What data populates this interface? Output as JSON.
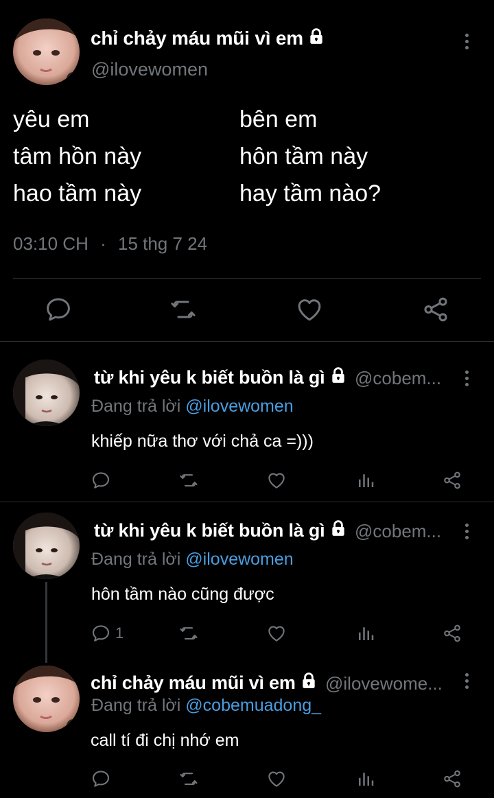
{
  "main_tweet": {
    "author_name": "chỉ chảy máu mũi vì em",
    "handle": "@ilovewomen",
    "poem_left": [
      "yêu em",
      "tâm hồn này",
      "hao tầm này"
    ],
    "poem_right": [
      "bên em",
      "hôn tầm này",
      "hay tầm nào?"
    ],
    "time": "03:10 CH",
    "separator": "·",
    "date": "15 thg 7 24"
  },
  "replies": [
    {
      "author_name": "từ khi yêu k biết buồn là gì",
      "handle": "@cobem...",
      "replying_prefix": "Đang trả lời",
      "replying_to": "@ilovewomen",
      "text": "khiếp nữa thơ với chả ca =)))",
      "reply_count": ""
    },
    {
      "author_name": "từ khi yêu k biết buồn là gì",
      "handle": "@cobem...",
      "replying_prefix": "Đang trả lời",
      "replying_to": "@ilovewomen",
      "text": "hôn tầm nào cũng được",
      "reply_count": "1"
    },
    {
      "author_name": "chỉ chảy máu mũi vì em",
      "handle": "@ilovewome...",
      "replying_prefix": "Đang trả lời",
      "replying_to": "@cobemuadong_",
      "text": "call tí đi chị nhớ em",
      "reply_count": ""
    }
  ],
  "icons": [
    "lock-icon",
    "more-icon",
    "reply-icon",
    "retweet-icon",
    "like-icon",
    "share-icon",
    "views-icon"
  ],
  "colors": {
    "background": "#000000",
    "text": "#ffffff",
    "muted": "#71767b",
    "link": "#4a9de0",
    "divider": "#2f3336"
  }
}
